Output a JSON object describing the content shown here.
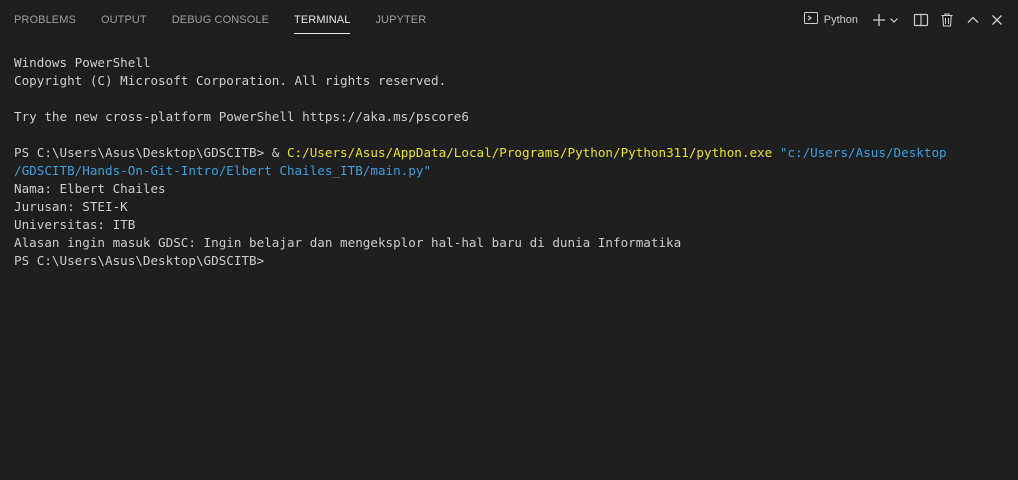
{
  "tabs": [
    {
      "label": "PROBLEMS",
      "active": false
    },
    {
      "label": "OUTPUT",
      "active": false
    },
    {
      "label": "DEBUG CONSOLE",
      "active": false
    },
    {
      "label": "TERMINAL",
      "active": true
    },
    {
      "label": "JUPYTER",
      "active": false
    }
  ],
  "actions": {
    "terminal_profile": "Python",
    "icons": [
      "terminal-icon",
      "plus-icon",
      "chevron-down-icon",
      "split-terminal-icon",
      "trash-icon",
      "chevron-up-icon",
      "close-icon"
    ]
  },
  "terminal": {
    "line1": "Windows PowerShell",
    "line2": "Copyright (C) Microsoft Corporation. All rights reserved.",
    "line3": "",
    "line4": "Try the new cross-platform PowerShell https://aka.ms/pscore6",
    "line5": "",
    "cmd_prompt": "PS C:\\Users\\Asus\\Desktop\\GDSCITB> ",
    "cmd_op": "& ",
    "cmd_exe": "C:/Users/Asus/AppData/Local/Programs/Python/Python311/python.exe",
    "cmd_arg_part1": " \"c:/Users/Asus/Desktop",
    "cmd_arg_part2": "/GDSCITB/Hands-On-Git-Intro/Elbert Chailes_ITB/main.py\"",
    "out1": "Nama: Elbert Chailes",
    "out2": "Jurusan: STEI-K",
    "out3": "Universitas: ITB",
    "out4": "Alasan ingin masuk GDSC: Ingin belajar dan mengeksplor hal-hal baru di dunia Informatika",
    "final_prompt": "PS C:\\Users\\Asus\\Desktop\\GDSCITB>"
  },
  "colors": {
    "background": "#1e1e1e",
    "text": "#cccccc",
    "exe": "#e5e510",
    "arg": "#3b9fdc"
  }
}
